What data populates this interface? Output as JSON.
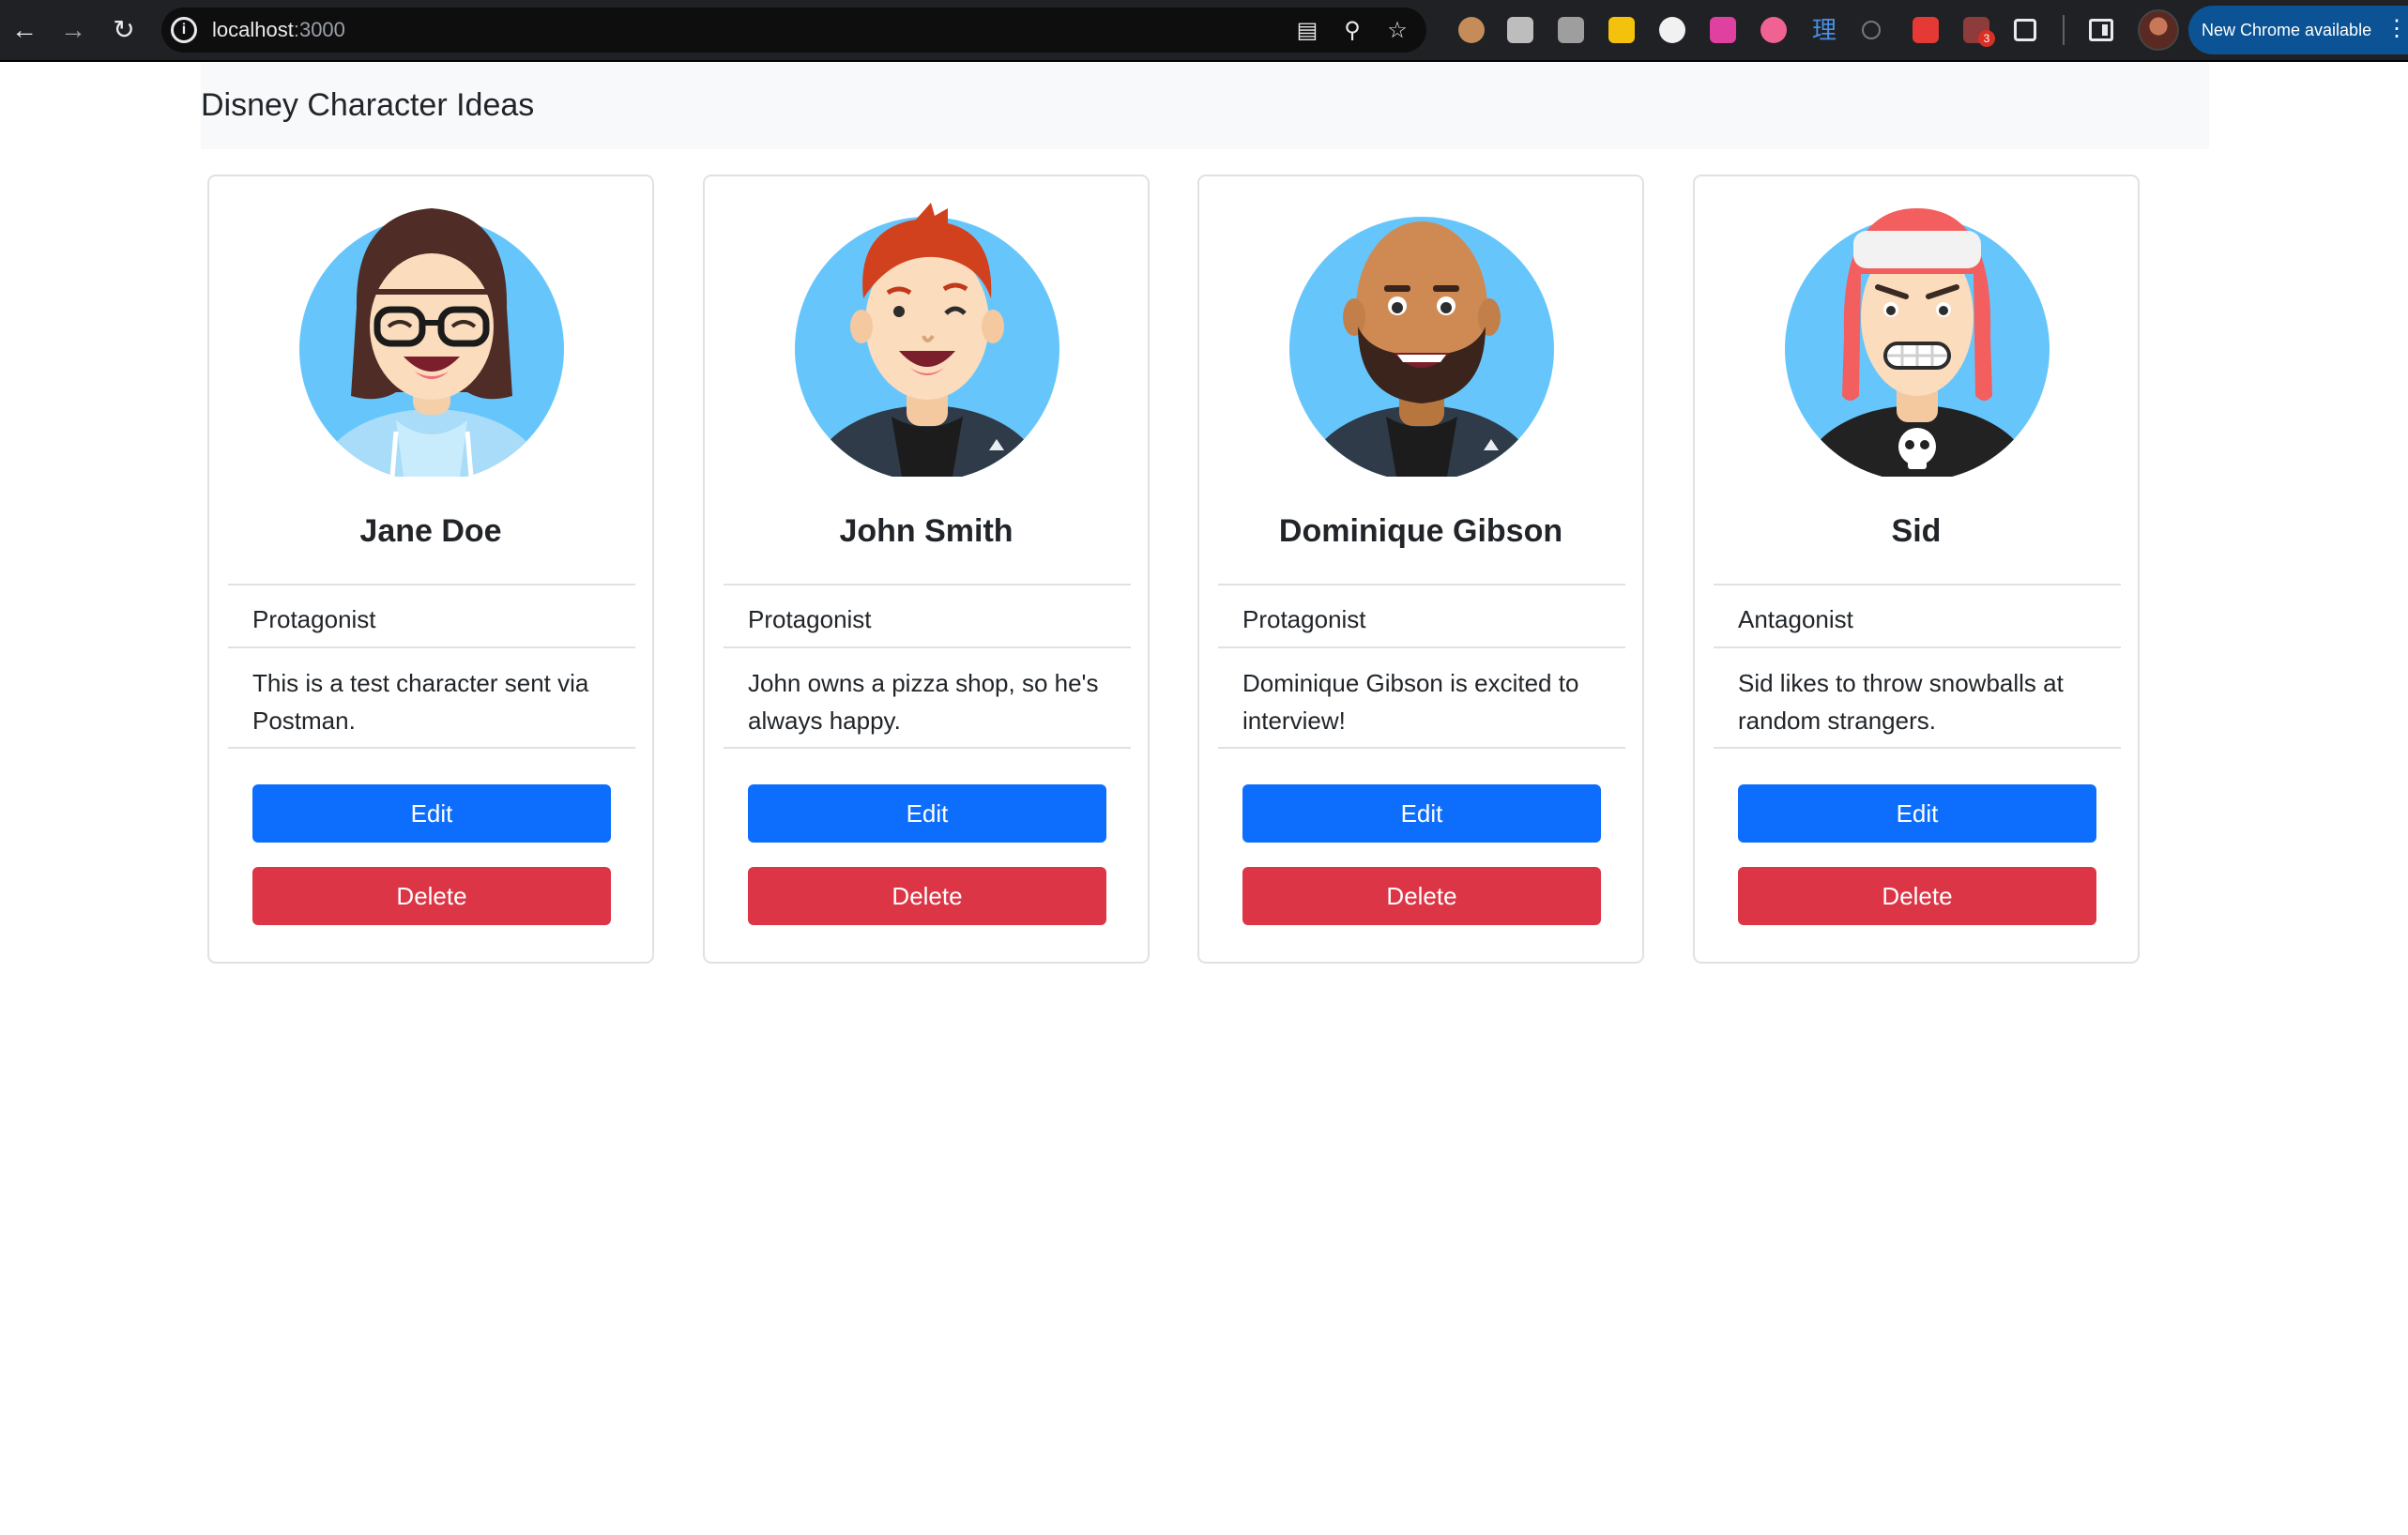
{
  "browser": {
    "url_host": "localhost",
    "url_port": ":3000",
    "update_label": "New Chrome available",
    "extension_badges": [
      "3"
    ]
  },
  "page": {
    "brand": "Disney Character Ideas"
  },
  "characters": [
    {
      "name": "Jane Doe",
      "role": "Protagonist",
      "description": "This is a test character sent via Postman.",
      "edit_label": "Edit",
      "delete_label": "Delete"
    },
    {
      "name": "John Smith",
      "role": "Protagonist",
      "description": "John owns a pizza shop, so he's always happy.",
      "edit_label": "Edit",
      "delete_label": "Delete"
    },
    {
      "name": "Dominique Gibson",
      "role": "Protagonist",
      "description": "Dominique Gibson is excited to interview!",
      "edit_label": "Edit",
      "delete_label": "Delete"
    },
    {
      "name": "Sid",
      "role": "Antagonist",
      "description": "Sid likes to throw snowballs at random strangers.",
      "edit_label": "Edit",
      "delete_label": "Delete"
    }
  ],
  "colors": {
    "primary": "#0d6efd",
    "danger": "#dc3545",
    "avatar_background": "#66c6fc",
    "navbar_background": "#f8f9fa"
  }
}
